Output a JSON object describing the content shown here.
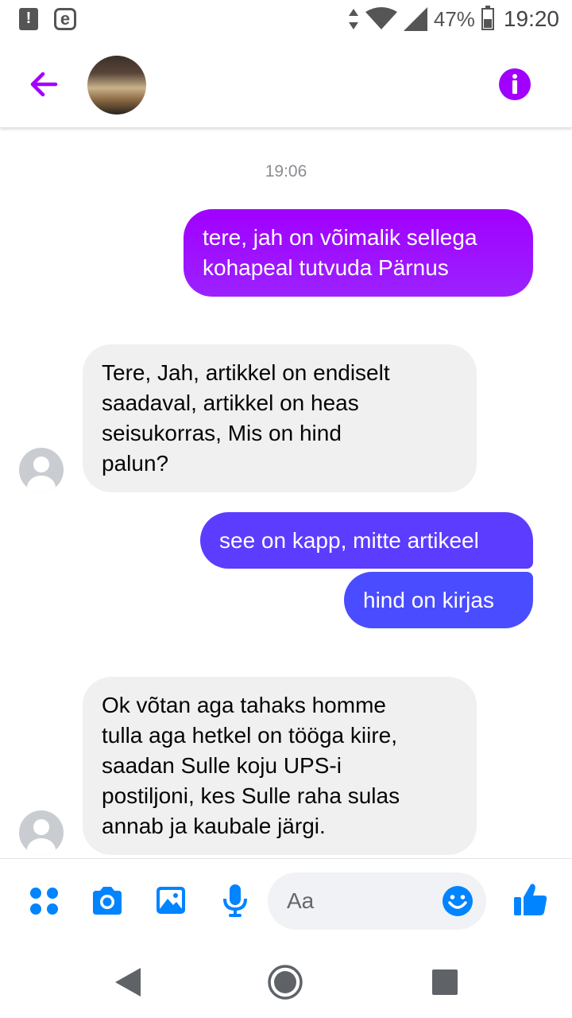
{
  "status_bar": {
    "battery": "47%",
    "time": "19:20",
    "icons": [
      "alert-icon",
      "e-app-icon",
      "data-arrows-icon",
      "wifi-icon",
      "signal-icon",
      "battery-icon"
    ]
  },
  "header": {
    "icons": [
      "back-arrow-icon",
      "info-icon"
    ],
    "accent_color": "#a100ff"
  },
  "conversation": {
    "timestamp": "19:06",
    "messages": [
      {
        "direction": "outgoing",
        "lines": [
          "tere, jah on võimalik sellega",
          "kohapeal tutvuda Pärnus"
        ],
        "color": "#9b1bff"
      },
      {
        "direction": "incoming",
        "lines": [
          "Tere, Jah, artikkel on endiselt",
          "saadaval, artikkel on heas",
          "seisukorras, Mis on hind",
          "palun?"
        ]
      },
      {
        "direction": "outgoing",
        "lines": [
          "see on kapp, mitte artikeel"
        ],
        "color": "#5c3cff"
      },
      {
        "direction": "outgoing",
        "lines": [
          "hind on kirjas"
        ],
        "color": "#4a4cff"
      },
      {
        "direction": "incoming",
        "lines": [
          "Ok võtan aga tahaks homme",
          "tulla aga hetkel on tööga kiire,",
          "saadan Sulle koju UPS-i",
          "postiljoni, kes Sulle raha sulas",
          "annab ja kaubale järgi."
        ]
      }
    ]
  },
  "composer": {
    "placeholder": "Aa",
    "icons": [
      "more-dots-icon",
      "camera-icon",
      "gallery-icon",
      "microphone-icon",
      "emoji-icon",
      "thumbs-up-icon"
    ],
    "accent_color": "#0084ff"
  },
  "navbar": {
    "icons": [
      "nav-back-icon",
      "nav-home-icon",
      "nav-recents-icon"
    ]
  }
}
